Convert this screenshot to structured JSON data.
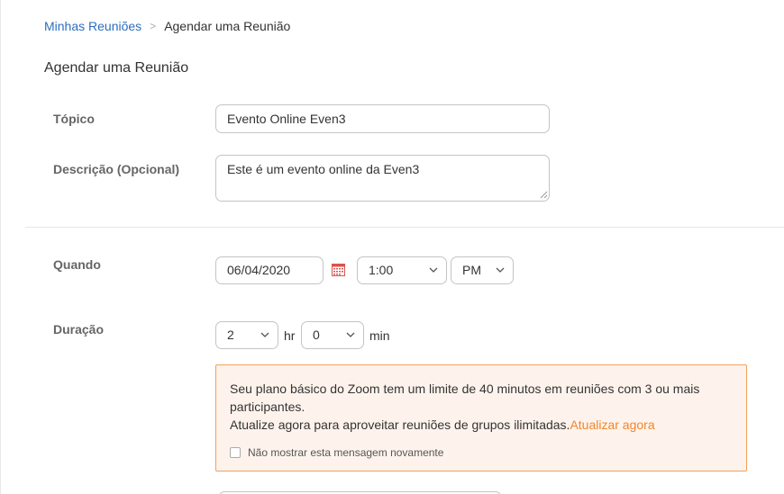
{
  "breadcrumb": {
    "parent": "Minhas Reuniões",
    "separator": ">",
    "current": "Agendar uma Reunião"
  },
  "page_title": "Agendar uma Reunião",
  "form": {
    "topic_label": "Tópico",
    "topic_value": "Evento Online Even3",
    "description_label": "Descrição (Opcional)",
    "description_value": "Este é um evento online da Even3",
    "when_label": "Quando",
    "date_value": "06/04/2020",
    "time_value": "1:00",
    "ampm_value": "PM",
    "duration_label": "Duração",
    "hours_value": "2",
    "hours_unit": "hr",
    "minutes_value": "0",
    "minutes_unit": "min"
  },
  "alert": {
    "line1": "Seu plano básico do Zoom tem um limite de 40 minutos em reuniões com 3 ou mais participantes.",
    "line2": "Atualize agora para aproveitar reuniões de grupos ilimitadas.",
    "link": "Atualizar agora",
    "checkbox_label": "Não mostrar esta mensagem novamente"
  },
  "icons": {
    "calendar": "calendar-icon",
    "dropdown": "chevron-down-icon"
  },
  "colors": {
    "link_blue": "#2d6ebf",
    "alert_border": "#f3a05c",
    "alert_bg": "#fef3ec",
    "alert_link": "#f0862c",
    "calendar_red": "#d9534f"
  }
}
